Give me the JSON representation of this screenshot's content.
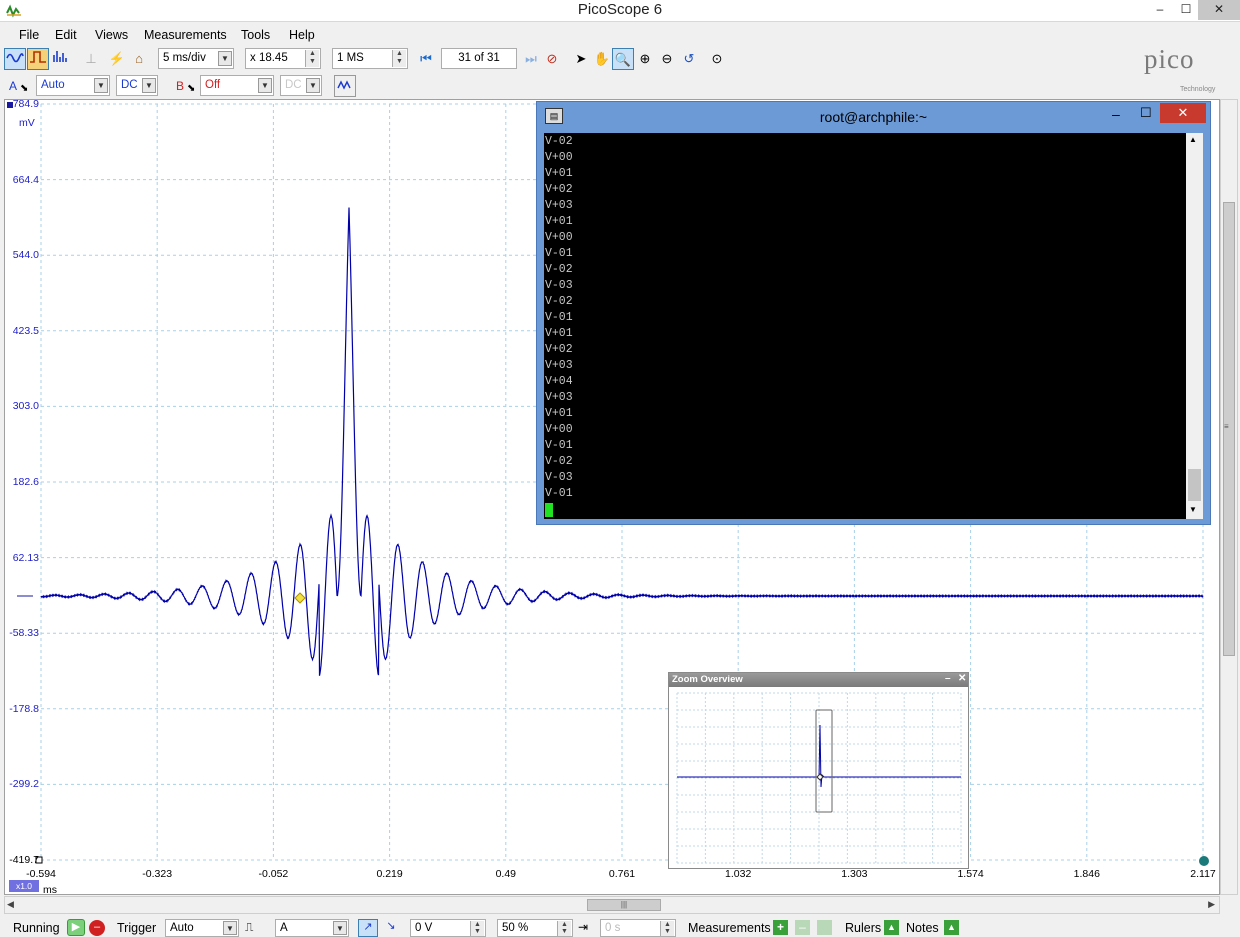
{
  "window": {
    "title": "PicoScope 6",
    "controls": [
      "–",
      "☐",
      "✕"
    ]
  },
  "menu": [
    "File",
    "Edit",
    "Views",
    "Measurements",
    "Tools",
    "Help"
  ],
  "toolbar": {
    "timebase": "5 ms/div",
    "zoom": "x 18.45",
    "samples": "1 MS",
    "buffer": "31 of 31",
    "logo_text": "pico",
    "logo_sub": "Technology"
  },
  "channels": {
    "a": {
      "label": "A",
      "range": "Auto",
      "coupling": "DC"
    },
    "b": {
      "label": "B",
      "range": "Off",
      "coupling": "DC"
    }
  },
  "scope": {
    "y_labels": [
      "784.9",
      "664.4",
      "544.0",
      "423.5",
      "303.0",
      "182.6",
      "62.13",
      "-58.33",
      "-178.8",
      "-299.2",
      "-419.7"
    ],
    "y_unit": "mV",
    "x_labels": [
      "-0.594",
      "-0.323",
      "-0.052",
      "0.219",
      "0.49",
      "0.761",
      "1.032",
      "1.303",
      "1.574",
      "1.846",
      "2.117"
    ],
    "x_unit": "ms",
    "x_scale": "x1.0",
    "trace_color": "#0000aa"
  },
  "terminal": {
    "title": "root@archphile:~",
    "lines": [
      "V-02",
      "V+00",
      "V+01",
      "V+02",
      "V+03",
      "V+01",
      "V+00",
      "V-01",
      "V-02",
      "V-03",
      "V-02",
      "V-01",
      "V+01",
      "V+02",
      "V+03",
      "V+04",
      "V+03",
      "V+01",
      "V+00",
      "V-01",
      "V-02",
      "V-03",
      "V-01"
    ]
  },
  "zoom_overview": {
    "title": "Zoom Overview"
  },
  "status": {
    "state": "Running",
    "trigger_label": "Trigger",
    "trigger_mode": "Auto",
    "trigger_channel": "A",
    "threshold": "0 V",
    "pretrigger": "50 %",
    "delay": "0 s",
    "measurements": "Measurements",
    "rulers": "Rulers",
    "notes": "Notes"
  }
}
